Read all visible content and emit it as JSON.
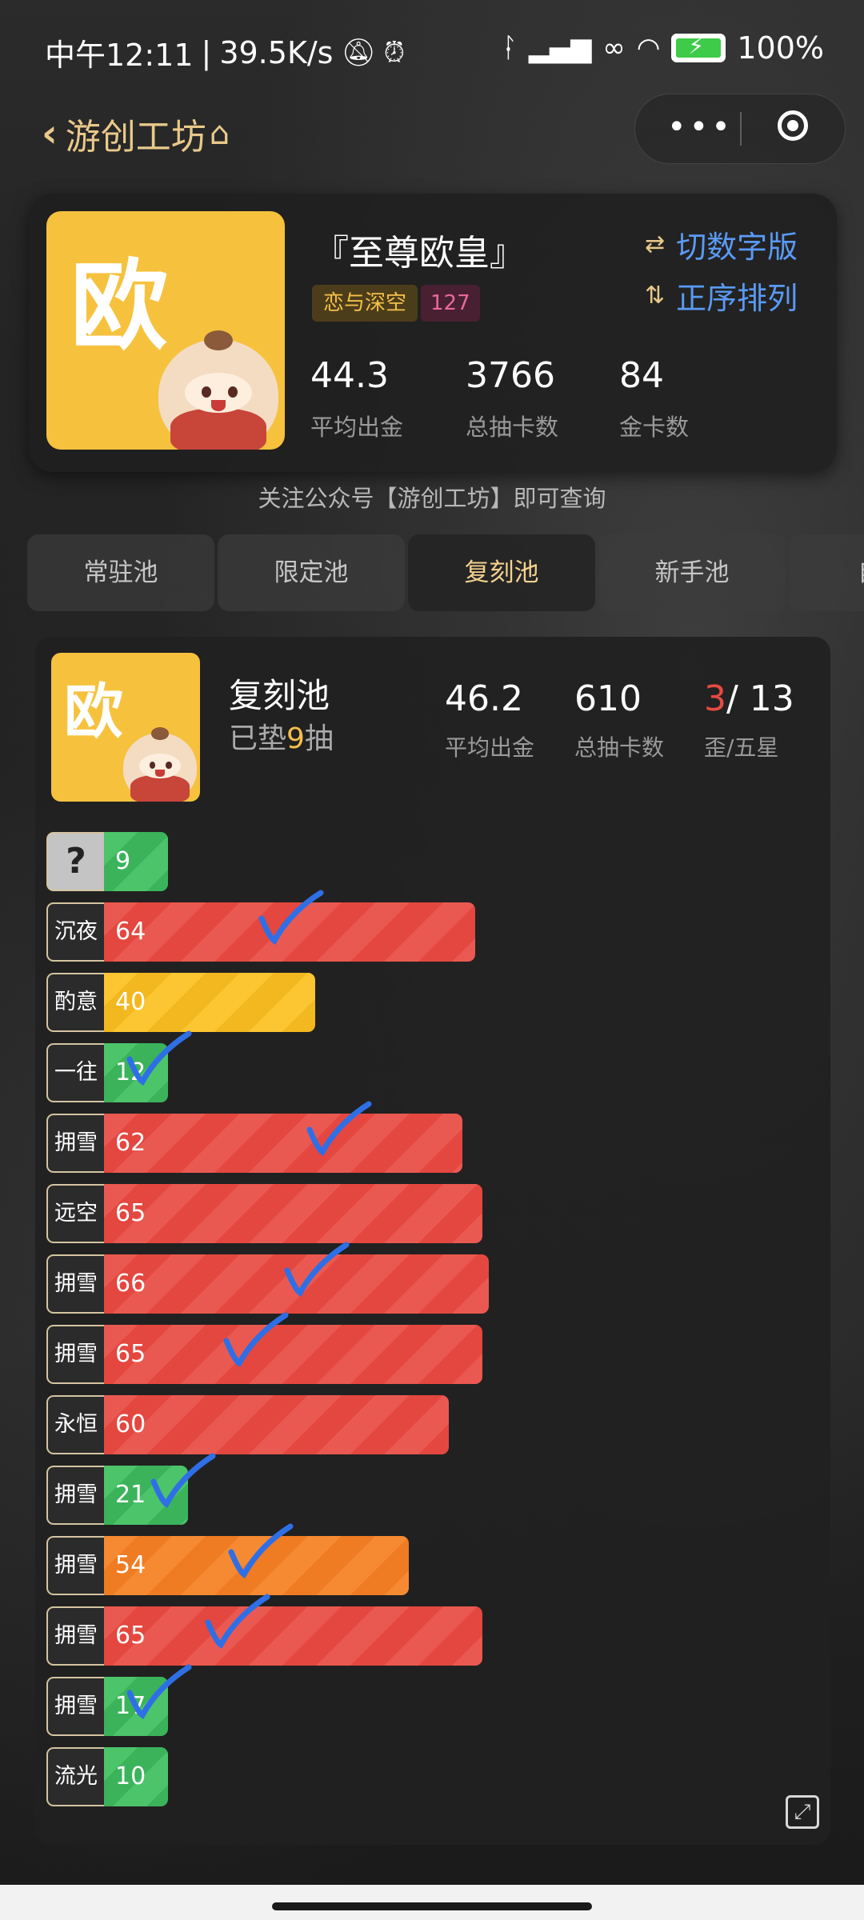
{
  "status_bar": {
    "time": "中午12:11",
    "sep": "|",
    "speed": "39.5K/s",
    "battery": "100%"
  },
  "nav": {
    "back_label": "游创工坊",
    "more_icon": "more-dots-icon",
    "close_icon": "target-icon"
  },
  "summary": {
    "avatar_char": "欧",
    "title": "『至尊欧皇』",
    "tag_game": "恋与深空",
    "tag_count": "127",
    "action_switch": "切数字版",
    "action_sort": "正序排列",
    "stats": [
      {
        "value": "44.3",
        "label": "平均出金"
      },
      {
        "value": "3766",
        "label": "总抽卡数"
      },
      {
        "value": "84",
        "label": "金卡数"
      }
    ]
  },
  "follow_text": "关注公众号【游创工坊】即可查询",
  "tabs": [
    "常驻池",
    "限定池",
    "复刻池",
    "新手池",
    "自选"
  ],
  "active_tab": 2,
  "pool": {
    "avatar_char": "欧",
    "name": "复刻池",
    "sub_prefix": "已垫",
    "sub_num": "9",
    "sub_suffix": "抽",
    "stats": [
      {
        "value": "46.2",
        "label": "平均出金"
      },
      {
        "value": "610",
        "label": "总抽卡数"
      }
    ],
    "miss_red": "3",
    "miss_rest": "/ 13",
    "miss_label": "歪/五星",
    "bars": [
      {
        "label": "?",
        "value": "9",
        "color": "green",
        "checked": false
      },
      {
        "label": "沉夜",
        "value": "64",
        "color": "red",
        "checked": true
      },
      {
        "label": "酌意",
        "value": "40",
        "color": "yellow",
        "checked": false
      },
      {
        "label": "一往",
        "value": "12",
        "color": "green",
        "checked": true
      },
      {
        "label": "拥雪",
        "value": "62",
        "color": "red",
        "checked": true
      },
      {
        "label": "远空",
        "value": "65",
        "color": "red",
        "checked": false
      },
      {
        "label": "拥雪",
        "value": "66",
        "color": "red",
        "checked": true
      },
      {
        "label": "拥雪",
        "value": "65",
        "color": "red",
        "checked": true
      },
      {
        "label": "永恒",
        "value": "60",
        "color": "red",
        "checked": false
      },
      {
        "label": "拥雪",
        "value": "21",
        "color": "green",
        "checked": true
      },
      {
        "label": "拥雪",
        "value": "54",
        "color": "orange",
        "checked": true
      },
      {
        "label": "拥雪",
        "value": "65",
        "color": "red",
        "checked": true
      },
      {
        "label": "拥雪",
        "value": "17",
        "color": "green",
        "checked": true
      },
      {
        "label": "流光",
        "value": "10",
        "color": "green",
        "checked": false
      }
    ],
    "expand_icon": "expand-icon"
  }
}
